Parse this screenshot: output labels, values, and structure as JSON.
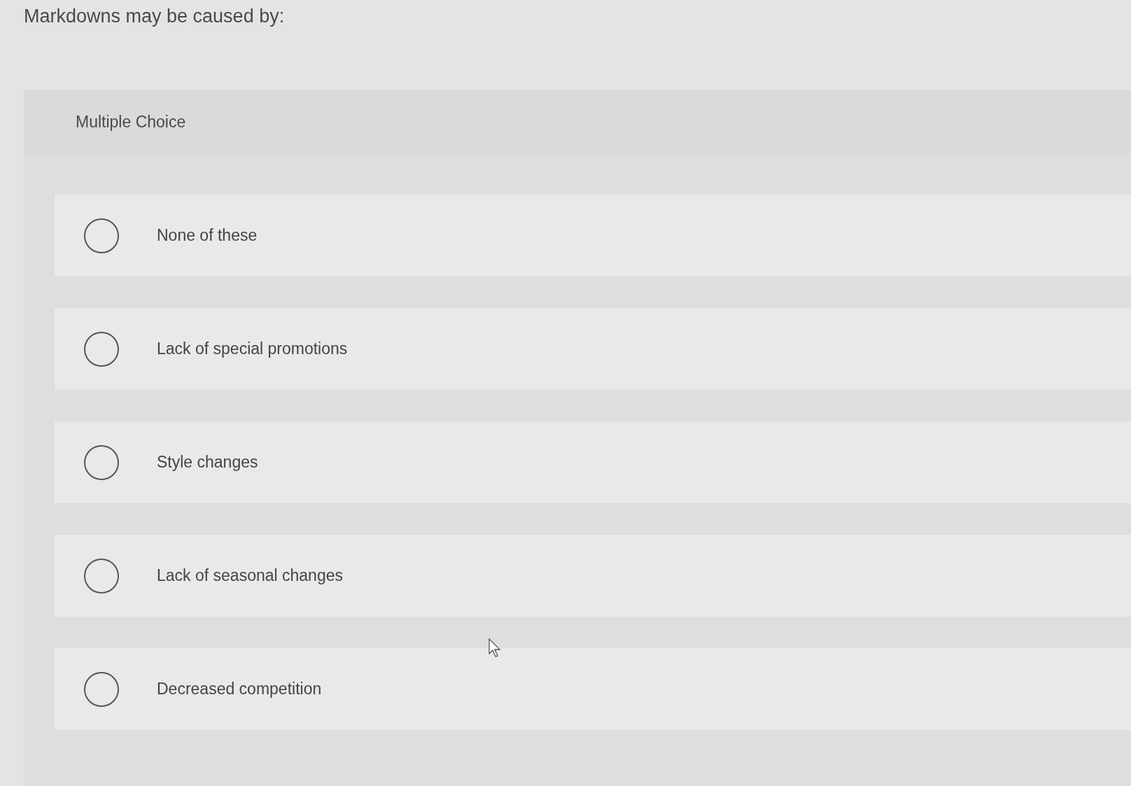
{
  "question": "Markdowns may be caused by:",
  "type_label": "Multiple Choice",
  "options": [
    {
      "label": "None of these",
      "selected": false
    },
    {
      "label": "Lack of special promotions",
      "selected": false
    },
    {
      "label": "Style changes",
      "selected": false
    },
    {
      "label": "Lack of seasonal changes",
      "selected": false
    },
    {
      "label": "Decreased competition",
      "selected": false
    }
  ]
}
